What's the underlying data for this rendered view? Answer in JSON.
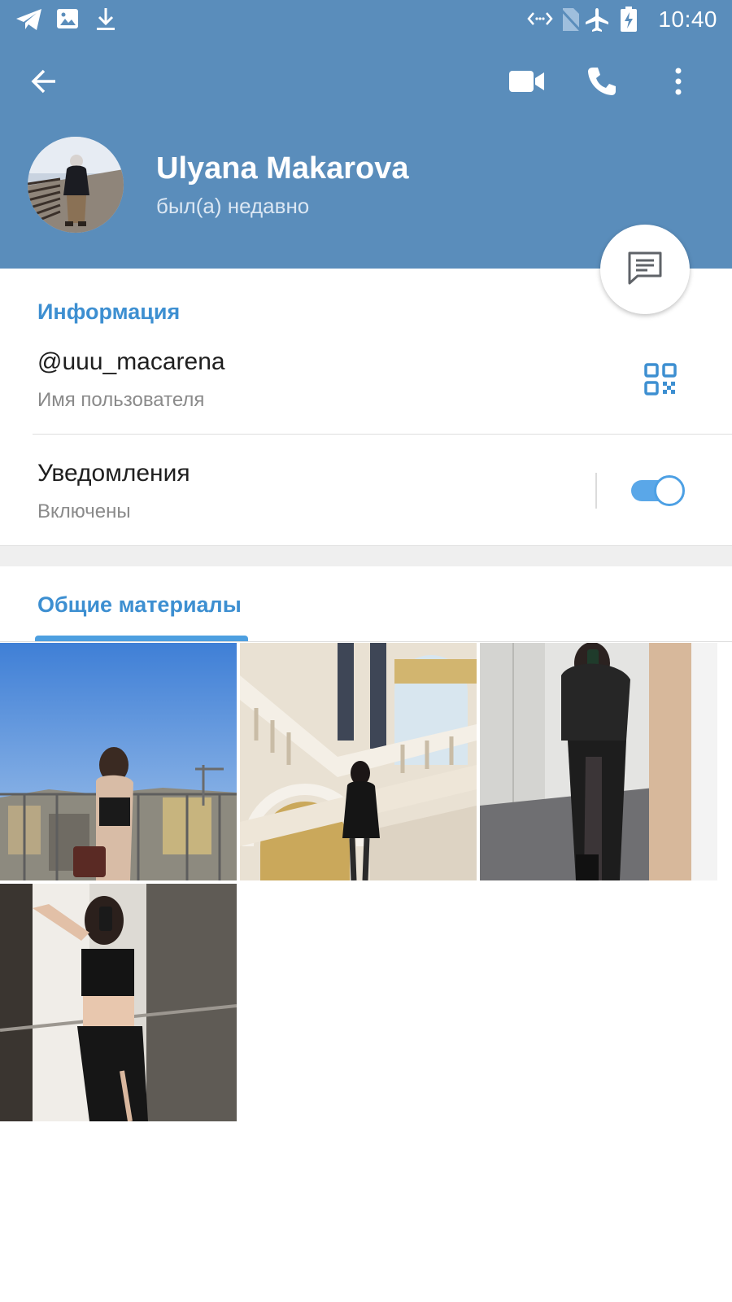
{
  "status_bar": {
    "time": "10:40",
    "left_icons": [
      "telegram-icon",
      "image-icon",
      "download-icon"
    ],
    "right_icons": [
      "data-saver-icon",
      "no-sim-icon",
      "airplane-icon",
      "battery-charging-icon"
    ]
  },
  "toolbar": {
    "buttons": [
      "back-arrow-icon",
      "video-call-icon",
      "phone-icon",
      "more-vert-icon"
    ]
  },
  "profile": {
    "name": "Ulyana Makarova",
    "status": "был(а) недавно"
  },
  "info_section": {
    "title": "Информация",
    "username": "@uuu_macarena",
    "username_caption": "Имя пользователя",
    "notifications_label": "Уведомления",
    "notifications_value": "Включены",
    "notifications_enabled": true
  },
  "media_section": {
    "tab_label": "Общие материалы",
    "photo_count": 4
  },
  "colors": {
    "header": "#5a8dbb",
    "accent": "#3d8fd1",
    "toggle": "#5aa7e8"
  }
}
